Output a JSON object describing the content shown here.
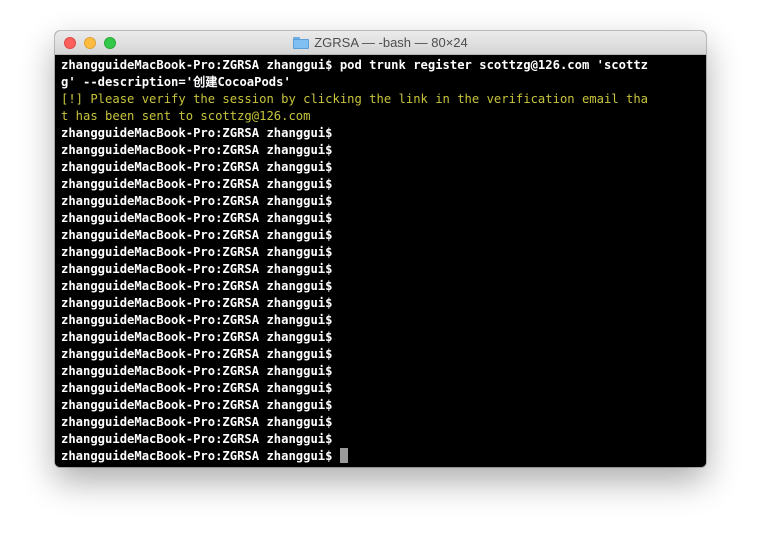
{
  "window": {
    "title": "ZGRSA — -bash — 80×24",
    "folder_icon": "folder-icon"
  },
  "terminal": {
    "prompt": "zhangguideMacBook-Pro:ZGRSA zhanggui$",
    "command_line_1": "zhangguideMacBook-Pro:ZGRSA zhanggui$ pod trunk register scottzg@126.com 'scottz",
    "command_line_2": "g' --description='创建CocoaPods'",
    "message_line_1": "[!] Please verify the session by clicking the link in the verification email tha",
    "message_line_2": "t has been sent to scottzg@126.com",
    "empty_prompt_count": 19,
    "message_color": "#c7c43b",
    "text_color": "#ffffff",
    "background_color": "#000000"
  }
}
